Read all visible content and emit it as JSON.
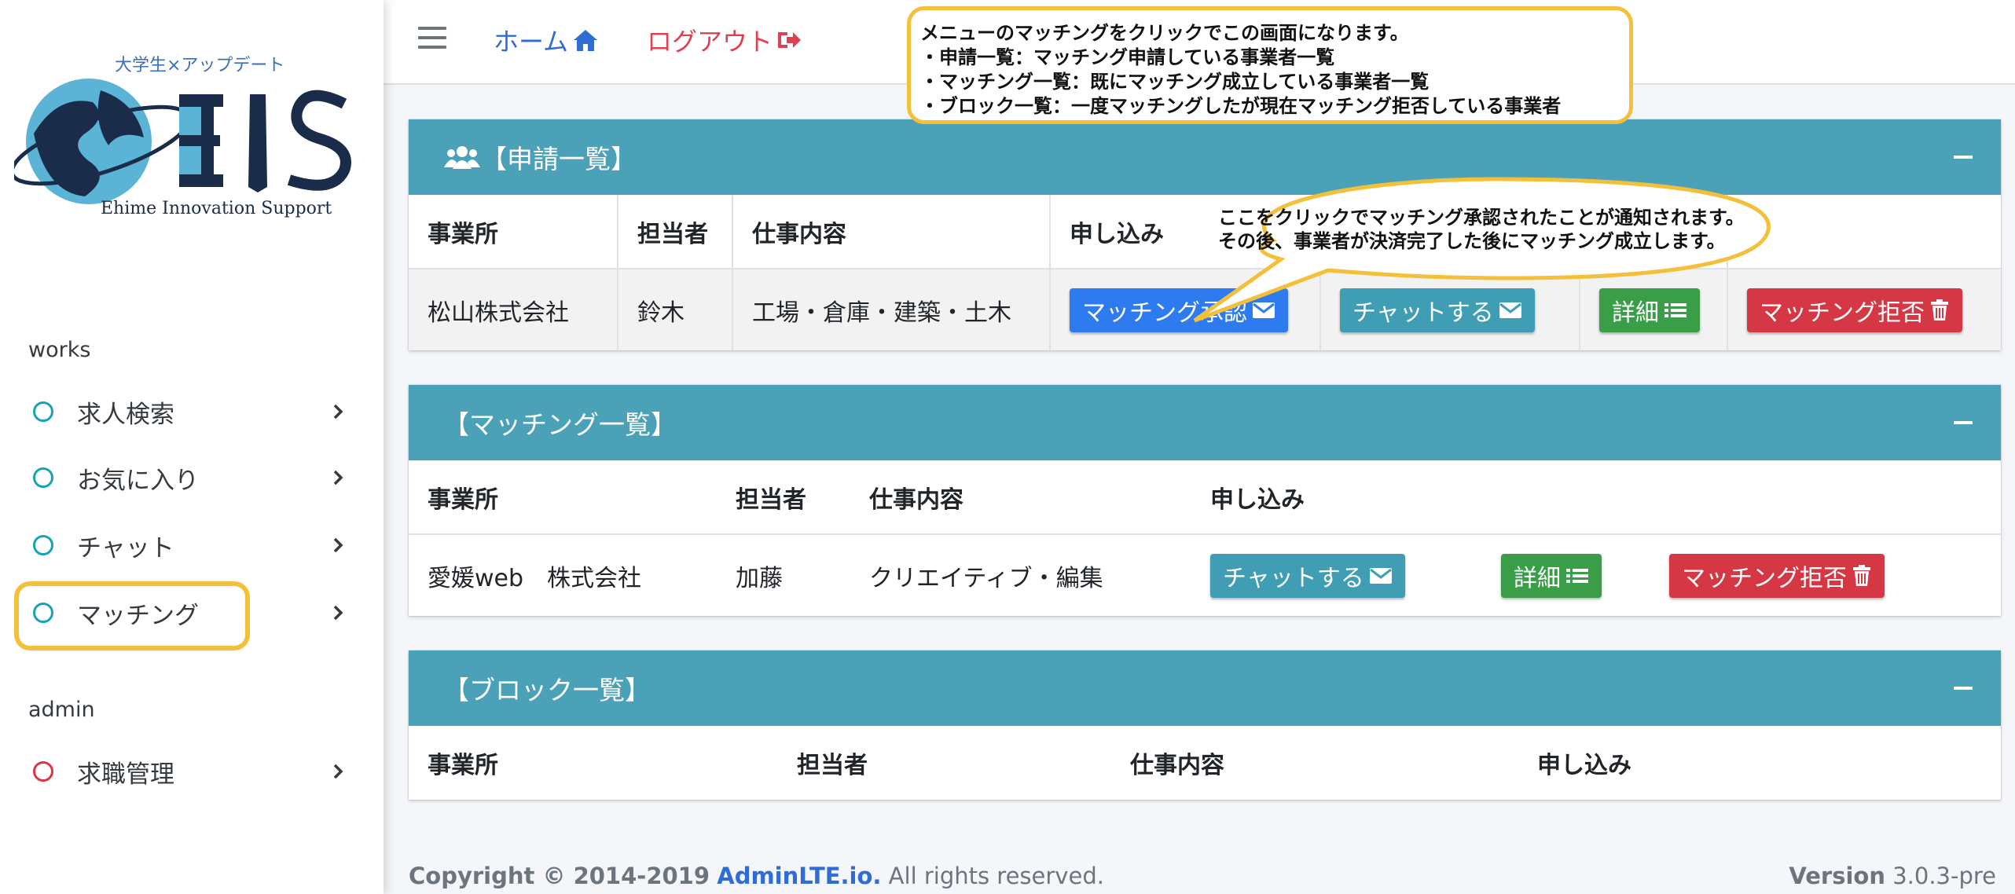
{
  "logo": {
    "tagline": "大学生×アップデート",
    "wordmark": "EIS",
    "subtitle": "Ehime Innovation Support"
  },
  "sidebar": {
    "sections": [
      {
        "label": "works",
        "items": [
          {
            "label": "求人検索",
            "icon": "circle-outline-icon",
            "color": "#17a2b8"
          },
          {
            "label": "お気に入り",
            "icon": "circle-outline-icon",
            "color": "#17a2b8"
          },
          {
            "label": "チャット",
            "icon": "circle-outline-icon",
            "color": "#17a2b8"
          },
          {
            "label": "マッチング",
            "icon": "circle-outline-icon",
            "color": "#17a2b8",
            "highlighted": true
          }
        ]
      },
      {
        "label": "admin",
        "items": [
          {
            "label": "求職管理",
            "icon": "circle-outline-icon",
            "color": "#dc3545"
          }
        ]
      }
    ]
  },
  "navbar": {
    "home_label": "ホーム",
    "logout_label": "ログアウト"
  },
  "callouts": {
    "top": [
      "メニューのマッチングをクリックでこの画面になります。",
      "・申請一覧：マッチング申請している事業者一覧",
      "・マッチング一覧：既にマッチング成立している事業者一覧",
      "・ブロック一覧：一度マッチングしたが現在マッチング拒否している事業者"
    ],
    "bubble": [
      "ここをクリックでマッチング承認されたことが通知されます。",
      "その後、事業者が決済完了した後にマッチング成立します。"
    ]
  },
  "cards": {
    "applications": {
      "title": "【申請一覧】",
      "icon": "users-icon",
      "headers": [
        "事業所",
        "担当者",
        "仕事内容",
        "申し込み"
      ],
      "rows": [
        {
          "office": "松山株式会社",
          "person": "鈴木",
          "job": "工場・倉庫・建築・土木",
          "buttons": {
            "approve": "マッチング承認",
            "chat": "チャットする",
            "detail": "詳細",
            "reject": "マッチング拒否"
          }
        }
      ]
    },
    "matches": {
      "title": "【マッチング一覧】",
      "headers": [
        "事業所",
        "担当者",
        "仕事内容",
        "申し込み"
      ],
      "rows": [
        {
          "office": "愛媛web　株式会社",
          "person": "加藤",
          "job": "クリエイティブ・編集",
          "buttons": {
            "chat": "チャットする",
            "detail": "詳細",
            "reject": "マッチング拒否"
          }
        }
      ]
    },
    "blocks": {
      "title": "【ブロック一覧】",
      "headers": [
        "事業所",
        "担当者",
        "仕事内容",
        "申し込み"
      ]
    }
  },
  "footer": {
    "copyright_prefix": "Copyright © 2014-2019",
    "brand": "AdminLTE.io.",
    "rights": "All rights reserved.",
    "version_label": "Version",
    "version_value": "3.0.3-pre"
  },
  "colors": {
    "card_header": "#4ba1b7",
    "primary": "#2e7bf0",
    "info": "#3f9eb3",
    "success": "#3a9d47",
    "danger": "#d53745",
    "highlight": "#f4c03a"
  }
}
